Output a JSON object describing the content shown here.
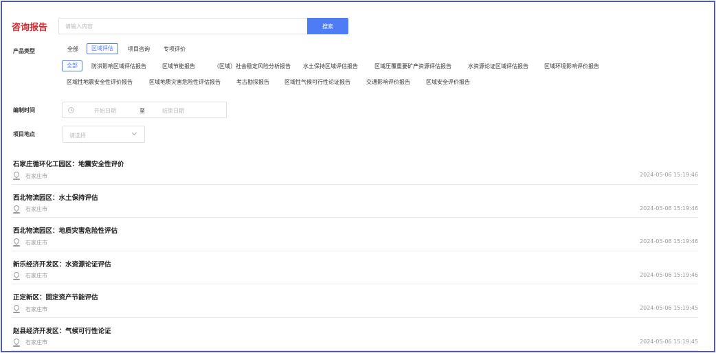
{
  "header": {
    "title": "咨询报告",
    "search_placeholder": "请输入内容",
    "search_button": "搜索"
  },
  "filters": {
    "product_type_label": "产品类型",
    "categories": [
      "全部",
      "区域评估",
      "项目咨询",
      "专项评价"
    ],
    "active_category": "区域评估",
    "subtypes_row1": [
      "全部",
      "防洪影响区域评估报告",
      "区域节能报告",
      "（区域）社会稳定风险分析报告",
      "水土保持区域评估报告",
      "区域压覆重要矿产资源评估报告",
      "水资源论证区域评估报告",
      "区域环境影响评价报告"
    ],
    "subtypes_row2": [
      "区域性地震安全性评价报告",
      "区域地质灾害危险性评估报告",
      "考古勘探报告",
      "区域性气候可行性论证报告",
      "交通影响评价报告",
      "区域安全评价报告"
    ],
    "active_subtype": "全部",
    "date_label": "编制时间",
    "date_start_placeholder": "开始日期",
    "date_separator": "至",
    "date_end_placeholder": "结束日期",
    "location_label": "项目地点",
    "location_placeholder": "请选择"
  },
  "results": [
    {
      "title": "石家庄循环化工园区：地震安全性评价",
      "location": "石家庄市",
      "time": "2024-05-06 15:19:46"
    },
    {
      "title": "西北物流园区：水土保持评估",
      "location": "石家庄市",
      "time": "2024-05-06 15:19:46"
    },
    {
      "title": "西北物流园区：地质灾害危险性评估",
      "location": "石家庄市",
      "time": "2024-05-06 15:19:46"
    },
    {
      "title": "新乐经济开发区：水资源论证评估",
      "location": "石家庄市",
      "time": "2024-05-06 15:19:46"
    },
    {
      "title": "正定新区：固定资产节能评估",
      "location": "石家庄市",
      "time": "2024-05-06 15:19:45"
    },
    {
      "title": "赵县经济开发区：气候可行性论证",
      "location": "石家庄市",
      "time": "2024-05-06 15:19:45"
    }
  ],
  "colors": {
    "accent": "#4d7cf5",
    "title_red": "#d4282c",
    "frame": "#4a57d6"
  }
}
